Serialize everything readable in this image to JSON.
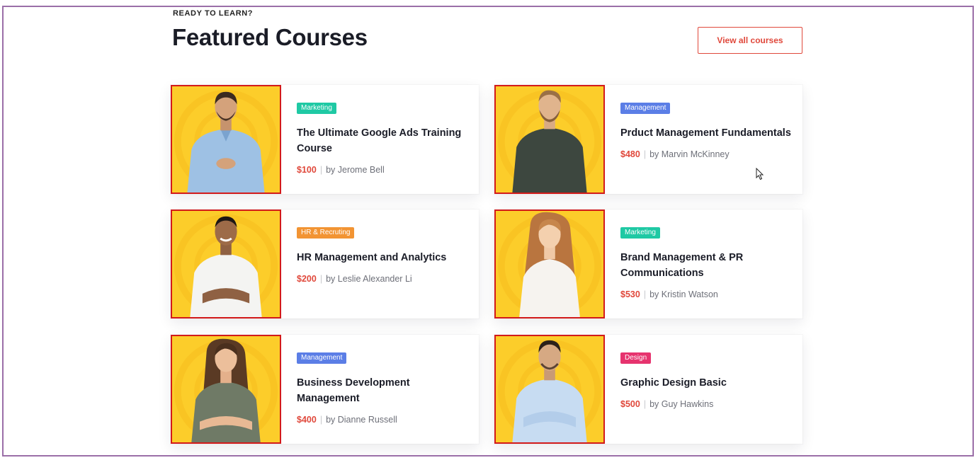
{
  "header": {
    "eyebrow": "READY TO LEARN?",
    "title": "Featured Courses",
    "view_all_label": "View all courses"
  },
  "colors": {
    "accent": "#e0483b",
    "thumb_bg": "#fccd2a",
    "highlight_border": "#d31a1a",
    "tag_marketing": "#1fc9a4",
    "tag_management": "#5b7ee6",
    "tag_hr": "#f29433",
    "tag_design": "#e6336e"
  },
  "courses": [
    {
      "tag": "Marketing",
      "title": "The Ultimate Google Ads Training Course",
      "price": "$100",
      "author": "by Jerome Bell"
    },
    {
      "tag": "Management",
      "title": "Prduct Management Fundamentals",
      "price": "$480",
      "author": "by Marvin McKinney"
    },
    {
      "tag": "HR & Recruting",
      "title": "HR  Management and Analytics",
      "price": "$200",
      "author": "by Leslie Alexander Li"
    },
    {
      "tag": "Marketing",
      "title": "Brand Management & PR Communications",
      "price": "$530",
      "author": "by Kristin Watson"
    },
    {
      "tag": "Management",
      "title": "Business Development Management",
      "price": "$400",
      "author": "by Dianne Russell"
    },
    {
      "tag": "Design",
      "title": "Graphic Design Basic",
      "price": "$500",
      "author": "by Guy Hawkins"
    }
  ],
  "separator": "|"
}
